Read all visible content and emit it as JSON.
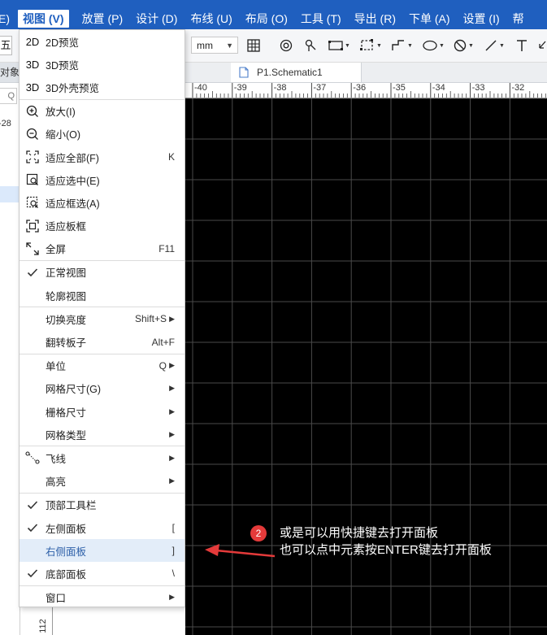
{
  "menu_bar": {
    "items": [
      {
        "label": "E)",
        "active": false
      },
      {
        "label": "视图 (V)",
        "active": true
      },
      {
        "label": "放置 (P)",
        "active": false
      },
      {
        "label": "设计 (D)",
        "active": false
      },
      {
        "label": "布线 (U)",
        "active": false
      },
      {
        "label": "布局 (O)",
        "active": false
      },
      {
        "label": "工具 (T)",
        "active": false
      },
      {
        "label": "导出 (R)",
        "active": false
      },
      {
        "label": "下单 (A)",
        "active": false
      },
      {
        "label": "设置 (I)",
        "active": false
      },
      {
        "label": "帮",
        "active": false
      }
    ],
    "bg_color": "#1f5fbf"
  },
  "toolbar": {
    "left_stub": "五",
    "unit_value": "mm",
    "tools": [
      "grid-icon",
      "target-icon",
      "probe-icon",
      "rect-icon",
      "dashed-rect-icon",
      "polyline-icon",
      "ellipse-icon",
      "no-entry-icon",
      "line-icon",
      "text-icon",
      "arrow-icon"
    ]
  },
  "tabs": {
    "left_tab": "对象",
    "document_tab": "P1.Schematic1"
  },
  "left_panel": {
    "search_glyph": "Q",
    "date_fragment": "-28"
  },
  "ruler": {
    "top_labels": [
      "-40",
      "-39",
      "-38",
      "-37",
      "-36",
      "-35",
      "-34",
      "-33",
      "-32",
      "-31"
    ],
    "left_label": "112"
  },
  "view_menu": {
    "groups": [
      [
        {
          "icon": "2D",
          "label": "2D预览"
        },
        {
          "icon": "3D",
          "label": "3D预览"
        },
        {
          "icon": "3D",
          "label": "3D外壳预览"
        }
      ],
      [
        {
          "icon": "zoom-in-icon",
          "label": "放大(I)"
        },
        {
          "icon": "zoom-out-icon",
          "label": "缩小(O)"
        },
        {
          "icon": "fit-all-icon",
          "label": "适应全部(F)",
          "shortcut": "K"
        },
        {
          "icon": "fit-selected-icon",
          "label": "适应选中(E)"
        },
        {
          "icon": "fit-box-icon",
          "label": "适应框选(A)"
        },
        {
          "icon": "fit-board-icon",
          "label": "适应板框"
        },
        {
          "icon": "fullscreen-icon",
          "label": "全屏",
          "shortcut": "F11"
        }
      ],
      [
        {
          "icon": "check-icon",
          "label": "正常视图"
        },
        {
          "icon": "",
          "label": "轮廓视图"
        }
      ],
      [
        {
          "icon": "",
          "label": "切换亮度",
          "shortcut": "Shift+S",
          "submenu": true
        },
        {
          "icon": "",
          "label": "翻转板子",
          "shortcut": "Alt+F"
        }
      ],
      [
        {
          "icon": "",
          "label": "单位",
          "shortcut": "Q",
          "submenu": true
        },
        {
          "icon": "",
          "label": "网格尺寸(G)",
          "submenu": true
        },
        {
          "icon": "",
          "label": "栅格尺寸",
          "submenu": true
        },
        {
          "icon": "",
          "label": "网格类型",
          "submenu": true
        }
      ],
      [
        {
          "icon": "ratline-icon",
          "label": "飞线",
          "submenu": true
        },
        {
          "icon": "",
          "label": "高亮",
          "submenu": true
        }
      ],
      [
        {
          "icon": "check-icon",
          "label": "顶部工具栏"
        },
        {
          "icon": "check-icon",
          "label": "左侧面板",
          "shortcut": "["
        },
        {
          "icon": "",
          "label": "右侧面板",
          "shortcut": "]",
          "highlighted": true
        },
        {
          "icon": "check-icon",
          "label": "底部面板",
          "shortcut": "\\"
        }
      ],
      [
        {
          "icon": "",
          "label": "窗口",
          "submenu": true
        }
      ]
    ]
  },
  "annotation": {
    "badge": "2",
    "line1": "或是可以用快捷键去打开面板",
    "line2": "也可以点中元素按ENTER键去打开面板",
    "arrow_color": "#e43a3a"
  }
}
